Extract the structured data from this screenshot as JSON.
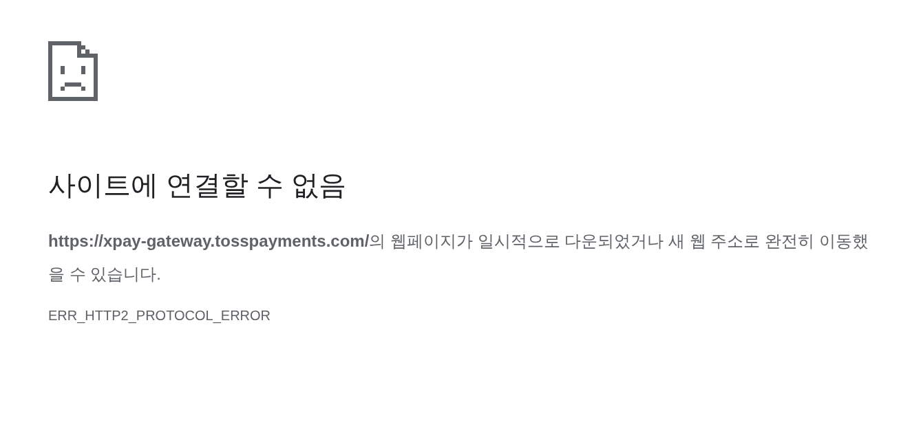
{
  "title": "사이트에 연결할 수 없음",
  "message": "**https://xpay-gateway.tosspayments.com/**의 웹페이지가 일시적으로 다운되었거나 새 웹 주소로 완전히 이동했을 수 있습니다.",
  "error_code": "ERR_HTTP2_PROTOCOL_ERROR"
}
